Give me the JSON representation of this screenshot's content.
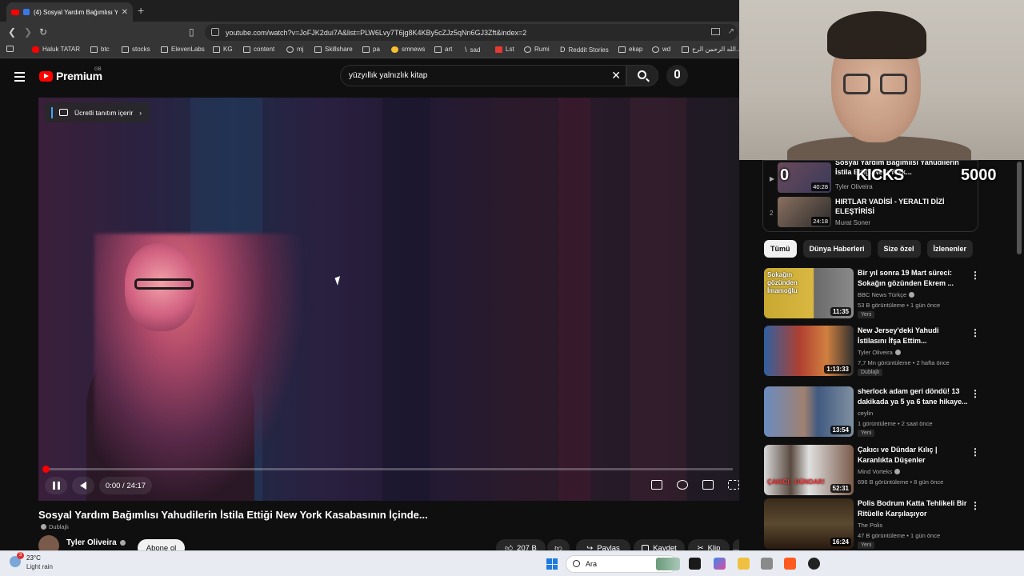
{
  "browser": {
    "tab_title": "(4) Sosyal Yardım Bağımlısı Ya",
    "url": "youtube.com/watch?v=JoFJK2dui7A&list=PLW6Lvy7T6jg8K4KBy5cZJz5qNn6GJ3Zft&index=2",
    "bookmarks": [
      "Haluk TATAR",
      "btc",
      "stocks",
      "ElevenLabs",
      "KG",
      "content",
      "mj",
      "Skillshare",
      "pa",
      "smnews",
      "art",
      "sad",
      "Lst",
      "Rumi",
      "Reddit Stories",
      "ekap",
      "wd",
      "الله الرحمن الرح..."
    ]
  },
  "youtube": {
    "brand": "Premium",
    "region": "GB",
    "search_value": "yüzyıllık yalnızlık kitap"
  },
  "video": {
    "promo_label": "Ücretli tanıtım içerir",
    "time": "0:00 / 24:17",
    "progress_fraction": 0.0,
    "title": "Sosyal Yardım Bağımlısı Yahudilerin İstila Ettiği New York Kasabasının İçinde...",
    "dubbed": "Dublajlı",
    "channel": "Tyler Oliveira",
    "subscribe_label": "Abone ol",
    "actions": {
      "likes": "207 B",
      "share": "Paylaş",
      "save": "Kaydet",
      "clip": "Klip",
      "more": "..."
    }
  },
  "playlist": [
    {
      "title": "Sosyal Yardım Bağımlısı Yahudilerin İstila Ettiği New York...",
      "channel": "Tyler Oliveira",
      "duration": "40:28"
    },
    {
      "index": "2",
      "title": "HIRTLAR VADİSİ - YERALTI DİZİ ELEŞTİRİSİ",
      "channel": "Murat Soner",
      "duration": "24:18"
    }
  ],
  "stream_overlay": {
    "left": "0",
    "center": "KICKS",
    "right": "5000"
  },
  "chips": [
    "Tümü",
    "Dünya Haberleri",
    "Size özel",
    "İzlenenler"
  ],
  "recommendations": [
    {
      "title": "Bir yıl sonra 19 Mart süreci: Sokağın gözünden Ekrem ...",
      "channel": "BBC News Türkçe",
      "meta": "53 B görüntüleme • 1 gün önce",
      "badge": "Yeni",
      "duration": "11:35",
      "thumb_text": "Sokağın gözünden İmamoğlu",
      "color": "#c8a830"
    },
    {
      "title": "New Jersey'deki Yahudi İstilasını İfşa Ettim...",
      "channel": "Tyler Oliveira",
      "meta": "7,7 Mn görüntüleme • 2 hafta önce",
      "badge": "Dublajlı",
      "duration": "1:13:33",
      "thumb_text": "",
      "color": "#b04030"
    },
    {
      "title": "sherlock adam geri döndü! 13 dakikada ya 5 ya 6 tane hikaye...",
      "channel": "ceylin",
      "meta": "1 görüntüleme • 2 saat önce",
      "badge": "Yeni",
      "duration": "13:54",
      "thumb_text": "",
      "color": "#6a8cc0"
    },
    {
      "title": "Çakıcı ve Dündar Kılıç | Karanlıkta Düşenler",
      "channel": "Mind Vorteks",
      "meta": "696 B görüntüleme • 8 gün önce",
      "badge": "",
      "duration": "52:31",
      "thumb_text": "ÇAKICI - DÜNDAR!",
      "color": "#5a4a40"
    },
    {
      "title": "Polis Bodrum Katta Tehlikeli Bir Ritüelle Karşılaşıyor",
      "channel": "The Polis",
      "meta": "47 B görüntüleme • 1 gün önce",
      "badge": "Yeni",
      "duration": "16:24",
      "thumb_text": "",
      "color": "#3a2a1a"
    }
  ],
  "taskbar": {
    "temp": "23°C",
    "condition": "Light rain",
    "badge": "3",
    "search": "Ara"
  }
}
